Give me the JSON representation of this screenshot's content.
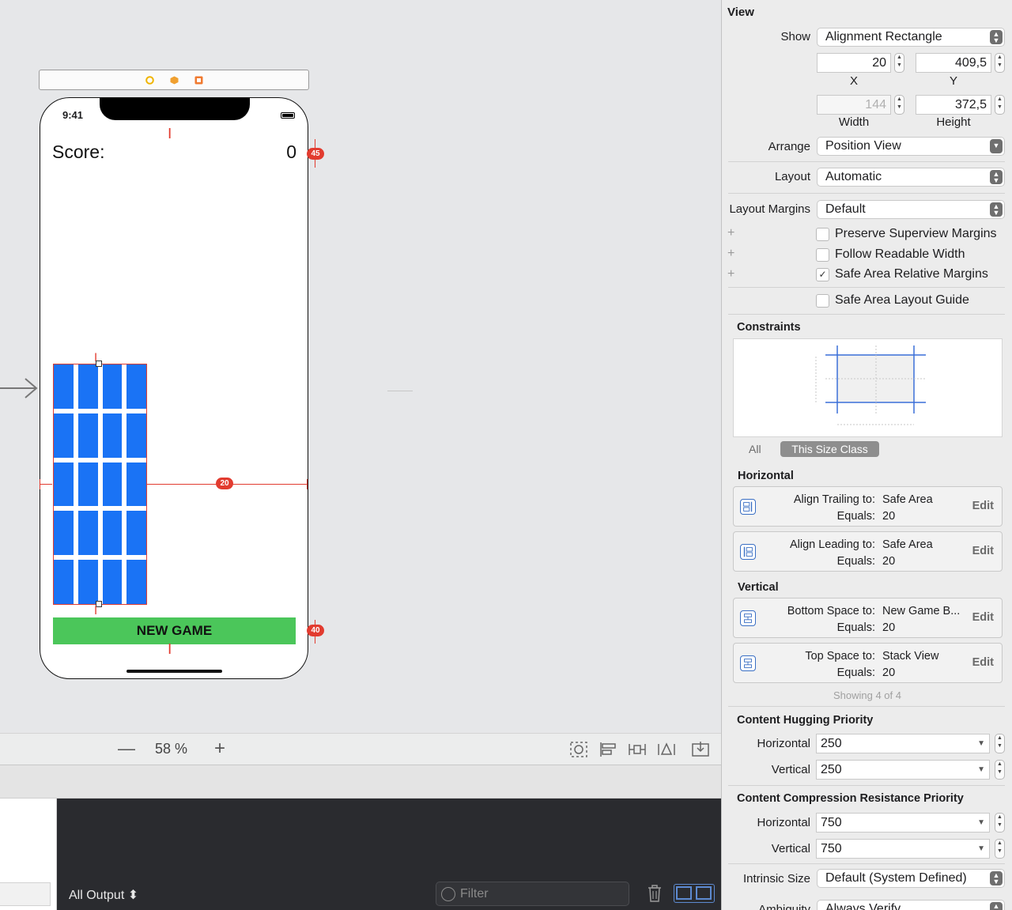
{
  "canvas": {
    "status_time": "9:41",
    "score_label": "Score:",
    "score_value": "0",
    "new_game": "NEW GAME",
    "badges": {
      "top": "45",
      "mid": "20",
      "bottom": "40"
    },
    "zoom": "58 %",
    "zoom_out": "—",
    "zoom_in": "+"
  },
  "debug": {
    "output_selector": "All Output ⬍",
    "filter_placeholder": "Filter"
  },
  "inspector": {
    "view_title": "View",
    "show_label": "Show",
    "show_value": "Alignment Rectangle",
    "x_value": "20",
    "y_value": "409,5",
    "x_label": "X",
    "y_label": "Y",
    "width_value": "144",
    "height_value": "372,5",
    "width_label": "Width",
    "height_label": "Height",
    "arrange_label": "Arrange",
    "arrange_value": "Position View",
    "layout_label": "Layout",
    "layout_value": "Automatic",
    "margins_label": "Layout Margins",
    "margins_value": "Default",
    "checkboxes": [
      {
        "label": "Preserve Superview Margins",
        "checked": false
      },
      {
        "label": "Follow Readable Width",
        "checked": false
      },
      {
        "label": "Safe Area Relative Margins",
        "checked": true
      },
      {
        "label": "Safe Area Layout Guide",
        "checked": false
      }
    ],
    "constraints_title": "Constraints",
    "tab_all": "All",
    "tab_size_class": "This Size Class",
    "horizontal_title": "Horizontal",
    "vertical_title": "Vertical",
    "constraints": [
      {
        "k1": "Align Trailing to:",
        "v1": "Safe Area",
        "k2": "Equals:",
        "v2": "20",
        "edit": "Edit"
      },
      {
        "k1": "Align Leading to:",
        "v1": "Safe Area",
        "k2": "Equals:",
        "v2": "20",
        "edit": "Edit"
      },
      {
        "k1": "Bottom Space to:",
        "v1": "New Game B...",
        "k2": "Equals:",
        "v2": "20",
        "edit": "Edit"
      },
      {
        "k1": "Top Space to:",
        "v1": "Stack View",
        "k2": "Equals:",
        "v2": "20",
        "edit": "Edit"
      }
    ],
    "showing": "Showing 4 of 4",
    "hugging_title": "Content Hugging Priority",
    "hug_h_label": "Horizontal",
    "hug_h_value": "250",
    "hug_v_label": "Vertical",
    "hug_v_value": "250",
    "compression_title": "Content Compression Resistance Priority",
    "comp_h_label": "Horizontal",
    "comp_h_value": "750",
    "comp_v_label": "Vertical",
    "comp_v_value": "750",
    "intrinsic_label": "Intrinsic Size",
    "intrinsic_value": "Default (System Defined)",
    "ambiguity_label": "Ambiguity",
    "ambiguity_value": "Always Verify"
  }
}
